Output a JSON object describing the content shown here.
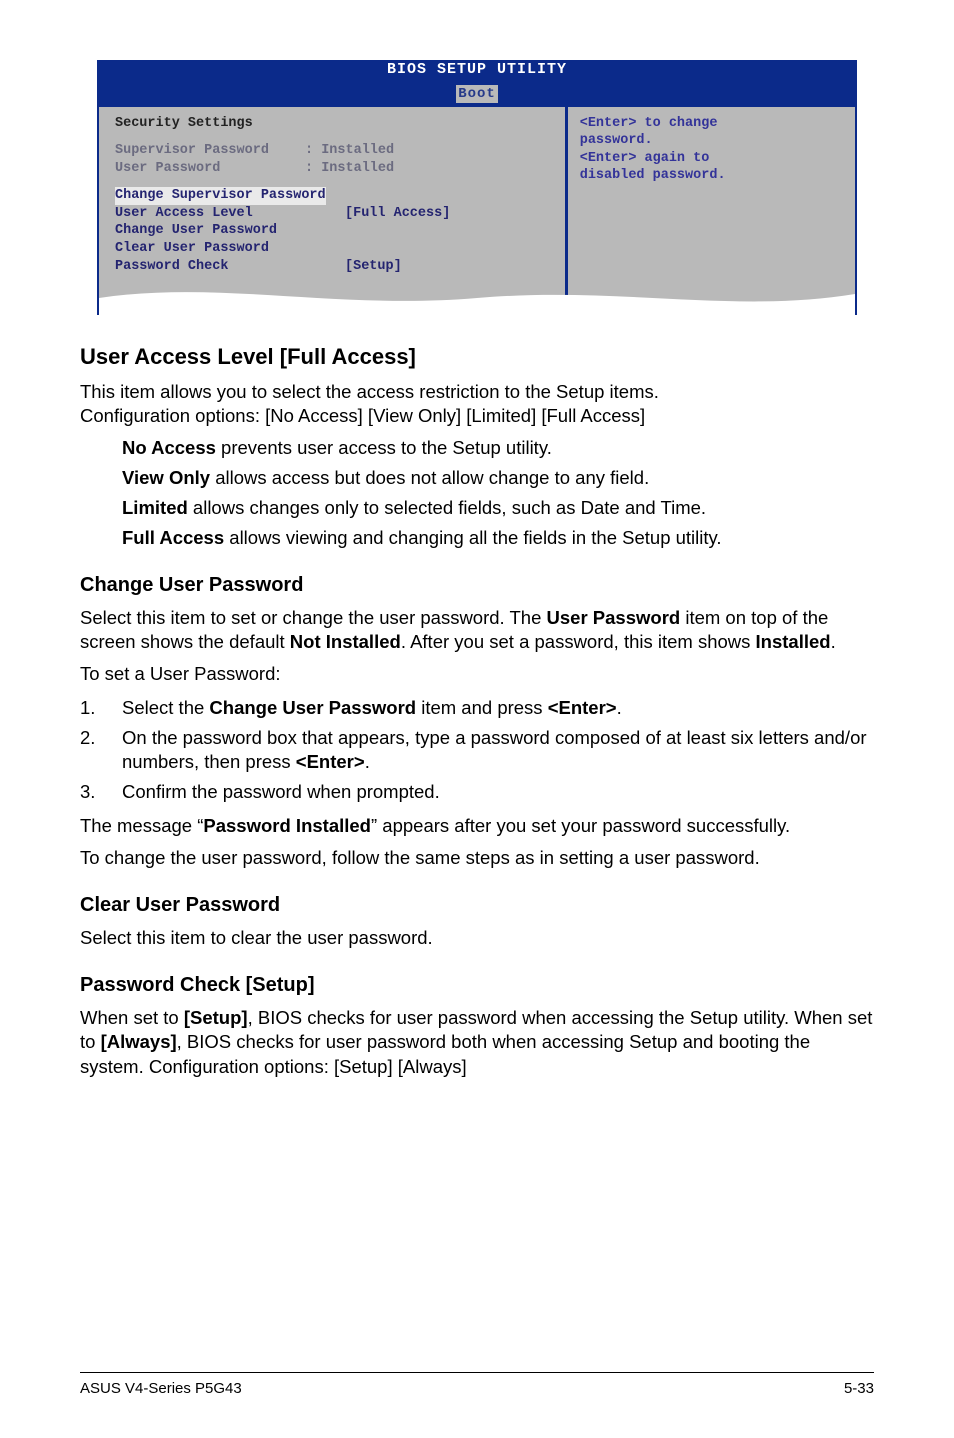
{
  "bios": {
    "title": "BIOS SETUP UTILITY",
    "tab": "Boot",
    "left": {
      "section_label": "Security Settings",
      "rows": [
        {
          "label": "Supervisor Password",
          "value": ": Installed"
        },
        {
          "label": "User Password",
          "value": ": Installed"
        }
      ],
      "highlight_row": "Change Supervisor Password",
      "active_rows": [
        {
          "label": "User Access Level",
          "value": "[Full Access]"
        },
        {
          "label": "Change User Password",
          "value": ""
        },
        {
          "label": "Clear User Password",
          "value": ""
        },
        {
          "label": "Password Check",
          "value": "[Setup]"
        }
      ]
    },
    "right": {
      "line1": "<Enter> to change",
      "line2": "password.",
      "line3": "<Enter> again to",
      "line4": "disabled password."
    }
  },
  "sections": {
    "userAccess": {
      "title": "User Access Level [Full Access]",
      "line1": "This item allows you to select the access restriction to the Setup items.",
      "line2": "Configuration options: [No Access] [View Only] [Limited] [Full Access]",
      "opts": {
        "noaccess_b": "No Access",
        "noaccess_t": " prevents user access to the Setup utility.",
        "viewonly_b": "View Only",
        "viewonly_t": " allows access but does not allow change to any field.",
        "limited_b": "Limited",
        "limited_t": " allows changes only to selected fields, such as Date and Time.",
        "fullaccess_b": "Full Access",
        "fullaccess_t": " allows viewing and changing all the fields in the Setup utility."
      }
    },
    "changeUser": {
      "title": "Change User Password",
      "p1a": "Select this item to set or change the user password. The ",
      "p1b": "User Password",
      "p1c": " item on top of the screen shows the default ",
      "p1d": "Not Installed",
      "p1e": ". After you set a password, this item shows ",
      "p1f": "Installed",
      "p1g": ".",
      "p2": "To set a User Password:",
      "step1": {
        "num": "1.",
        "a": "Select the ",
        "b": "Change User Password",
        "c": " item and press ",
        "d": "<Enter>",
        "e": "."
      },
      "step2": {
        "num": "2.",
        "a": "On the password box that appears, type a password composed of at least six letters and/or numbers, then press ",
        "b": "<Enter>",
        "c": "."
      },
      "step3": {
        "num": "3.",
        "a": "Confirm the password when prompted."
      },
      "p3a": "The message “",
      "p3b": "Password Installed",
      "p3c": "” appears after you set your password successfully.",
      "p4": "To change the user password, follow the same steps as in setting a user password."
    },
    "clearUser": {
      "title": "Clear User Password",
      "p1": "Select this item to clear the user password."
    },
    "passwordCheck": {
      "title": "Password Check [Setup]",
      "p_a": "When set to ",
      "p_b": "[Setup]",
      "p_c": ", BIOS checks for user password when accessing the Setup utility. When set to ",
      "p_d": "[Always]",
      "p_e": ", BIOS checks for user password both when accessing Setup and booting the system. Configuration options: [Setup] [Always]"
    }
  },
  "footer": {
    "left": "ASUS V4-Series P5G43",
    "right": "5-33"
  }
}
